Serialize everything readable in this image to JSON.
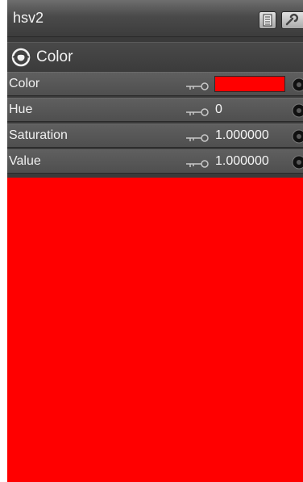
{
  "window": {
    "title": "hsv2"
  },
  "section": {
    "label": "Color",
    "icon": "eye-icon"
  },
  "params": [
    {
      "label": "Color",
      "value": "",
      "key_icon": "key-icon"
    },
    {
      "label": "Hue",
      "value": "0",
      "key_icon": "key-icon"
    },
    {
      "label": "Saturation",
      "value": "1.000000",
      "key_icon": "key-icon"
    },
    {
      "label": "Value",
      "value": "1.000000",
      "key_icon": "key-icon"
    }
  ],
  "colors": {
    "swatch": "#ff0000",
    "panel": "#3a3a3a"
  },
  "toolbar_icons": [
    "document-icon",
    "wrench-icon"
  ]
}
